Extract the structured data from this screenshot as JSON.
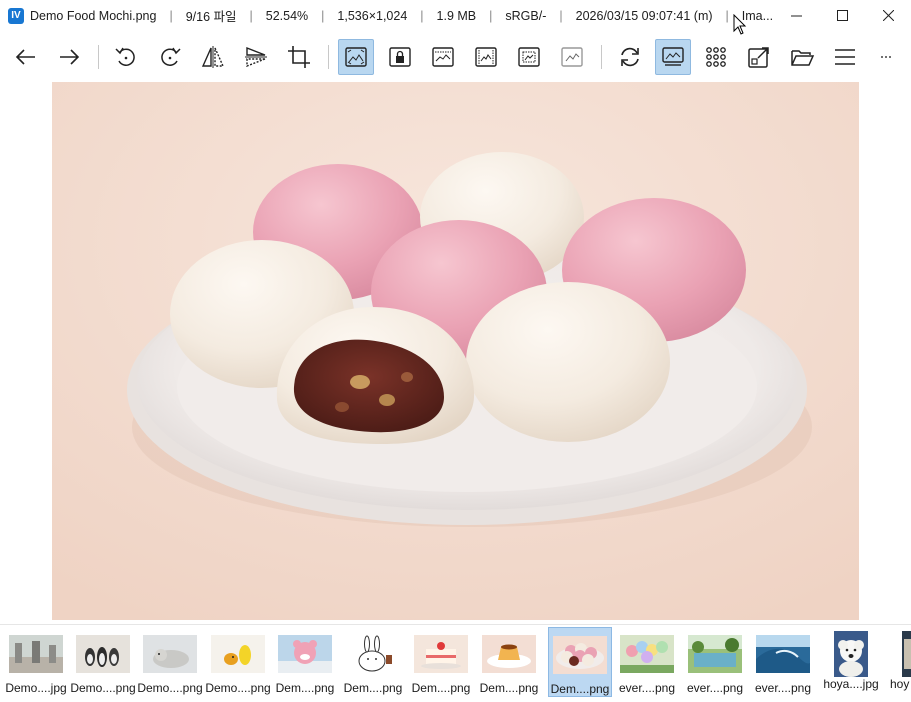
{
  "window": {
    "title_segments": [
      "Demo Food Mochi.png",
      "9/16 파일",
      "52.54%",
      "1,536×1,024",
      "1.9 MB",
      "sRGB/-",
      "2026/03/15 09:07:41 (m)",
      "Ima..."
    ],
    "minimize": "minimize-icon",
    "maximize": "maximize-icon",
    "close": "close-icon"
  },
  "toolbar": {
    "buttons": [
      {
        "icon": "arrow-left-icon",
        "active": false
      },
      {
        "icon": "arrow-right-icon",
        "active": false
      },
      {
        "icon": "rotate-left-icon",
        "active": false
      },
      {
        "icon": "rotate-right-icon",
        "active": false
      },
      {
        "icon": "flip-horizontal-icon",
        "active": false
      },
      {
        "icon": "flip-vertical-icon",
        "active": false
      },
      {
        "icon": "crop-icon",
        "active": false
      },
      {
        "icon": "fit-window-icon",
        "active": true
      },
      {
        "icon": "lock-zoom-icon",
        "active": false
      },
      {
        "icon": "fit-width-icon",
        "active": false
      },
      {
        "icon": "fit-height-icon",
        "active": false
      },
      {
        "icon": "fit-screen-icon",
        "active": false
      },
      {
        "icon": "actual-size-icon",
        "active": false
      },
      {
        "icon": "refresh-icon",
        "active": false
      },
      {
        "icon": "slideshow-icon",
        "active": true
      },
      {
        "icon": "grid-view-icon",
        "active": false
      },
      {
        "icon": "open-external-icon",
        "active": false
      },
      {
        "icon": "open-folder-icon",
        "active": false
      },
      {
        "icon": "menu-icon",
        "active": false
      },
      {
        "icon": "more-icon",
        "active": false
      }
    ]
  },
  "viewer": {
    "image": "mochi-photo",
    "background": "#f3ddd2"
  },
  "thumbnails": [
    {
      "label": "Demo....jpg",
      "selected": false,
      "kind": "statues"
    },
    {
      "label": "Demo....png",
      "selected": false,
      "kind": "penguins"
    },
    {
      "label": "Demo....png",
      "selected": false,
      "kind": "seal"
    },
    {
      "label": "Demo....png",
      "selected": false,
      "kind": "duck"
    },
    {
      "label": "Dem....png",
      "selected": false,
      "kind": "pink-bear"
    },
    {
      "label": "Dem....png",
      "selected": false,
      "kind": "rabbit"
    },
    {
      "label": "Dem....png",
      "selected": false,
      "kind": "cake"
    },
    {
      "label": "Dem....png",
      "selected": false,
      "kind": "pudding"
    },
    {
      "label": "Dem....png",
      "selected": true,
      "kind": "mochi"
    },
    {
      "label": "ever....png",
      "selected": false,
      "kind": "balloons"
    },
    {
      "label": "ever....png",
      "selected": false,
      "kind": "pool"
    },
    {
      "label": "ever....png",
      "selected": false,
      "kind": "wave"
    },
    {
      "label": "hoya....jpg",
      "selected": false,
      "kind": "dog"
    },
    {
      "label": "hoy",
      "selected": false,
      "kind": "partial"
    }
  ],
  "colors": {
    "accent": "#b9d7f0",
    "accent_border": "#8fb9e0",
    "brand": "#1877d2"
  }
}
